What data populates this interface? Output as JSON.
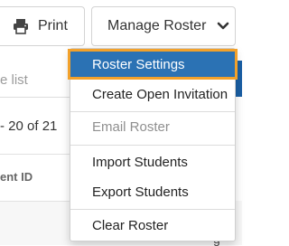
{
  "toolbar": {
    "print_label": "Print",
    "print_icon": "printer-icon",
    "roster_label": "Manage Roster",
    "roster_icon": "chevron-down-icon"
  },
  "background": {
    "search_placeholder": "e list",
    "pager_text": "- 20 of 21",
    "column_header": "ent ID",
    "bottom_fragment": "g"
  },
  "menu": {
    "items": [
      {
        "label": "Roster Settings",
        "state": "selected"
      },
      {
        "label": "Create Open Invitation",
        "state": "normal"
      },
      {
        "label": "Email Roster",
        "state": "disabled"
      },
      {
        "label": "Import Students",
        "state": "normal"
      },
      {
        "label": "Export Students",
        "state": "normal"
      },
      {
        "label": "Clear Roster",
        "state": "normal"
      }
    ]
  },
  "colors": {
    "selected_bg": "#2b72b4",
    "focus_outline": "#f2a12b",
    "accent": "#1a5fa4"
  }
}
